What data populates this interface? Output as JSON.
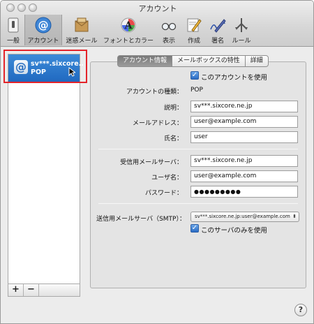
{
  "window": {
    "title": "アカウント"
  },
  "toolbar": [
    {
      "label": "一般",
      "icon": "switch-icon"
    },
    {
      "label": "アカウント",
      "icon": "at-sign-icon"
    },
    {
      "label": "迷惑メール",
      "icon": "junk-mail-icon"
    },
    {
      "label": "フォントとカラー",
      "icon": "font-color-icon"
    },
    {
      "label": "表示",
      "icon": "glasses-icon"
    },
    {
      "label": "作成",
      "icon": "pencil-icon"
    },
    {
      "label": "署名",
      "icon": "signature-icon"
    },
    {
      "label": "ルール",
      "icon": "rules-icon"
    }
  ],
  "accounts": [
    {
      "name": "sv***.sixcore..",
      "type": "POP"
    }
  ],
  "list_footer": {
    "add": "+",
    "remove": "−"
  },
  "tabs": [
    "アカウント情報",
    "メールボックスの特性",
    "詳細"
  ],
  "account_info": {
    "enable_label": "このアカウントを使用",
    "enable_checked": true,
    "type_label": "アカウントの種類：",
    "type_value": "POP",
    "description_label": "説明：",
    "description_value": "sv***.sixcore.ne.jp",
    "email_label": "メールアドレス：",
    "email_value": "user@example.com",
    "fullname_label": "氏名：",
    "fullname_value": "user",
    "incoming_server_label": "受信用メールサーバ：",
    "incoming_server_value": "sv***.sixcore.ne.jp",
    "username_label": "ユーザ名：",
    "username_value": "user@example.com",
    "password_label": "パスワード：",
    "password_value": "●●●●●●●●●",
    "smtp_label": "送信用メールサーバ（SMTP）：",
    "smtp_value": "sv***.sixcore.ne.jp:user@example.com",
    "smtp_only_label": "このサーバのみを使用",
    "smtp_only_checked": true
  },
  "help": "?"
}
